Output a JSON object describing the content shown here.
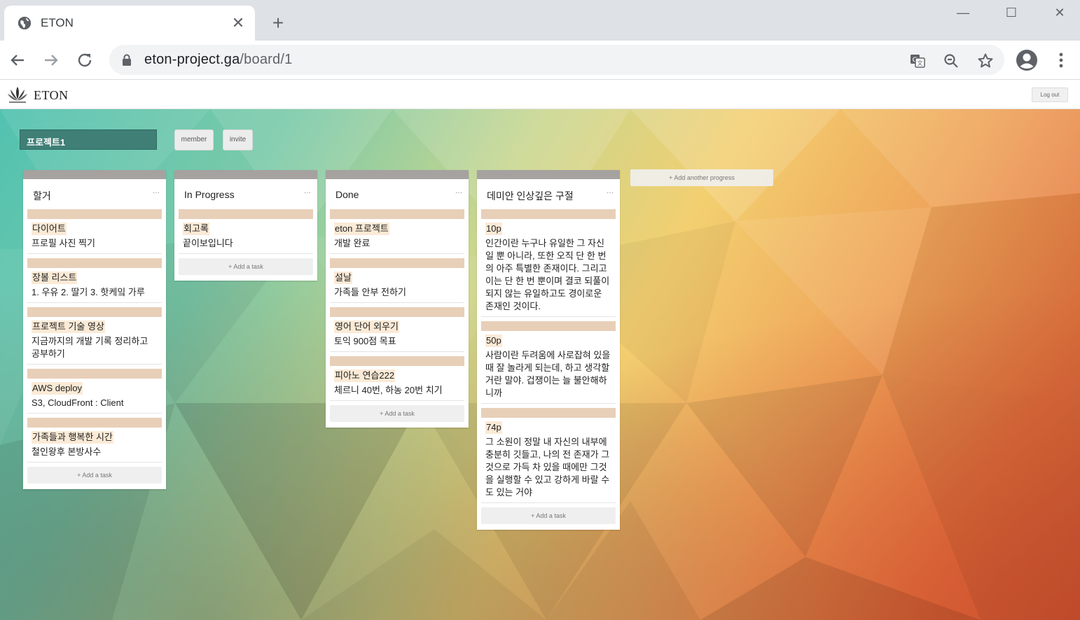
{
  "browser": {
    "tab_title": "ETON",
    "url_host": "eton-project.ga",
    "url_path": "/board/1"
  },
  "app": {
    "brand": "ETON",
    "logout_label": "Log out"
  },
  "board": {
    "project_title": "프로젝트1",
    "member_label": "member",
    "invite_label": "invite",
    "add_progress_label": "+ Add another progress",
    "add_task_label": "+ Add a task",
    "menu_dots": "···",
    "columns": [
      {
        "title": "할거",
        "cards": [
          {
            "title": "다이어트",
            "body": "프로필 사진 찍기"
          },
          {
            "title": "장볼 리스트",
            "body": "1. 우유 2. 딸기 3. 핫케잌 가루"
          },
          {
            "title": "프로젝트 기술 영상",
            "body": "지금까지의 개발 기록 정리하고 공부하기"
          },
          {
            "title": "AWS deploy",
            "body": "S3, CloudFront : Client"
          },
          {
            "title": "가족들과 행복한 시간",
            "body": "철인왕후 본방사수"
          }
        ]
      },
      {
        "title": "In Progress",
        "cards": [
          {
            "title": "회고록",
            "body": "끝이보입니다"
          }
        ]
      },
      {
        "title": "Done",
        "cards": [
          {
            "title": "eton 프로젝트",
            "body": "개발 완료"
          },
          {
            "title": "설날",
            "body": "가족들 안부 전하기"
          },
          {
            "title": "영어 단어 외우기",
            "body": "토익 900점 목표"
          },
          {
            "title": "피아노 연습222",
            "body": "체르니 40번, 하농 20번 치기"
          }
        ]
      },
      {
        "title": "데미안 인상깊은 구절",
        "cards": [
          {
            "title": "10p",
            "body": "인간이란 누구나 유일한 그 자신일 뿐 아니라, 또한 오직 단 한 번의 아주 특별한 존재이다. 그리고 이는 단 한 번 뿐이며 결코 되풀이되지 않는 유일하고도 경이로운 존재인 것이다."
          },
          {
            "title": "50p",
            "body": "사람이란 두려움에 사로잡혀 있을 때 잘 놀라게 되는데, 하고 생각할 거란 말야. 겁쟁이는 늘 불안해하니까"
          },
          {
            "title": "74p",
            "body": "그 소원이 정말 내 자신의 내부에 충분히 깃들고, 나의 전 존재가 그것으로 가득 차 있을 때에만 그것을 실행할 수 있고 강하게 바랄 수도 있는 거야"
          }
        ]
      }
    ]
  },
  "colors": {
    "project_title_bg": "#3f7f76",
    "card_bar": "#e8cfb8",
    "card_title_highlight": "#fbead6",
    "column_top_bar": "#a5a2a0"
  }
}
